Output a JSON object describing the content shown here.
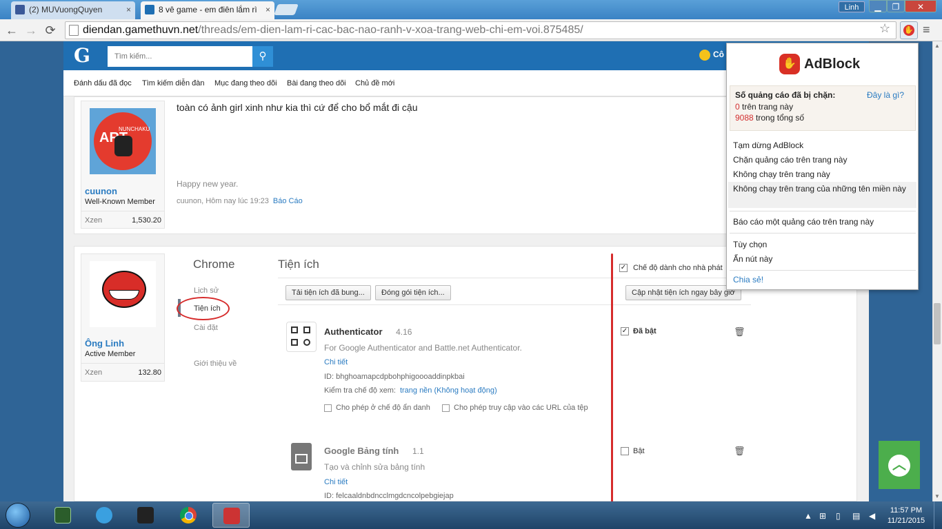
{
  "browser": {
    "tabs": [
      {
        "label": "(2) MUVuongQuyen",
        "close": "×"
      },
      {
        "label": "8 vê game - em điên lắm rì",
        "close": "×"
      }
    ],
    "user": "Linh",
    "window_buttons": {
      "min": "▁",
      "max": "❐",
      "close": "✕"
    },
    "url_domain": "diendan.gamethuvn.net",
    "url_path": "/threads/em-dien-lam-ri-cac-bac-nao-ranh-v-xoa-trang-web-chi-em-voi.875485/"
  },
  "site": {
    "logo": "G",
    "search_placeholder": "Tìm kiếm...",
    "user_label": "Cô",
    "subnav": [
      "Đánh dấu đã đọc",
      "Tìm kiếm diễn đàn",
      "Mục đang theo dõi",
      "Bài đang theo dõi",
      "Chủ đề mới"
    ]
  },
  "post1": {
    "message": "toàn có ảnh girl xinh như kia thì cứ để cho bổ mắt đi cậu",
    "signature": "Happy new year.",
    "meta": "cuunon, Hôm nay lúc 19:23",
    "report": "Báo Cáo",
    "avatar_text": "ART",
    "avatar_small": "NUNCHAKU",
    "user": {
      "name": "cuunon",
      "role": "Well-Known Member",
      "xzen_label": "Xzen",
      "xzen": "1,530.20"
    }
  },
  "post2": {
    "user": {
      "name": "Ông Linh",
      "role": "Active Member",
      "xzen_label": "Xzen",
      "xzen": "132.80"
    }
  },
  "chrome_ext": {
    "title": "Chrome",
    "nav": {
      "history": "Lịch sử",
      "extensions": "Tiện ích",
      "settings": "Cài đặt",
      "about": "Giới thiệu về"
    },
    "page_title": "Tiện ích",
    "dev_mode": "Chế độ dành cho nhà phát",
    "btn_load": "Tải tiện ích đã bung...",
    "btn_pack": "Đóng gói tiện ích...",
    "btn_update": "Cập nhật tiện ích ngay bây giờ",
    "extensions": [
      {
        "name": "Authenticator",
        "version": "4.16",
        "desc": "For Google Authenticator and Battle.net Authenticator.",
        "details": "Chi tiết",
        "id": "ID: bhghoamapcdpbohphigoooaddinpkbai",
        "inspect_label": "Kiểm tra chế độ xem:",
        "inspect_link": "trang nền (Không hoạt động)",
        "opt_incognito": "Cho phép ở chế độ ẩn danh",
        "opt_files": "Cho phép truy cập vào các URL của tệp",
        "enabled_label": "Đã bật"
      },
      {
        "name": "Google Bảng tính",
        "version": "1.1",
        "desc": "Tạo và chỉnh sửa bảng tính",
        "details": "Chi tiết",
        "id": "ID: felcaaldnbdncclmgdcncolpebgiejap",
        "enabled_label": "Bật"
      }
    ]
  },
  "adblock": {
    "name": "AdBlock",
    "stats_heading": "Số quảng cáo đã bị chặn:",
    "whats_this": "Đây là gì?",
    "page_count": "0",
    "page_label": "trên trang này",
    "total_count": "9088",
    "total_label": "trong tổng số",
    "menu": [
      "Tạm dừng AdBlock",
      "Chặn quảng cáo trên trang này",
      "Không chạy trên trang này",
      "Không chạy trên trang của những tên miền này",
      "Báo cáo một quảng cáo trên trang này",
      "Tùy chọn",
      "Ẩn nút này"
    ],
    "share": "Chia sẻ!"
  },
  "taskbar": {
    "time": "11:57 PM",
    "date": "11/21/2015"
  }
}
